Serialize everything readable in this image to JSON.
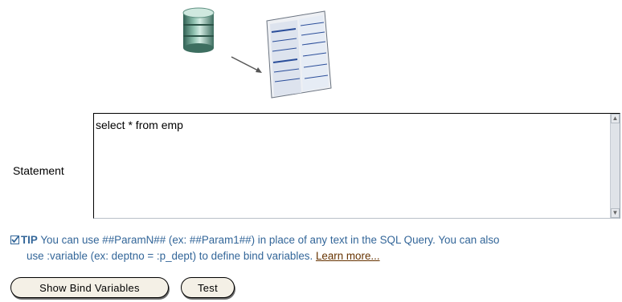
{
  "statement": {
    "label": "Statement",
    "value": "select * from emp"
  },
  "tip": {
    "label": "TIP",
    "line1": " You can use ##ParamN## (ex: ##Param1##) in place of any text in the SQL Query. You can also",
    "line2": "use :variable (ex: deptno = :p_dept) to define bind variables.",
    "link": "Learn more..."
  },
  "buttons": {
    "show_bind_variables": "Show Bind Variables",
    "test": "Test"
  },
  "icons": {
    "database": "database-icon",
    "report": "report-page-icon",
    "arrow": "arrow-icon",
    "tip": "checkmark-icon"
  }
}
